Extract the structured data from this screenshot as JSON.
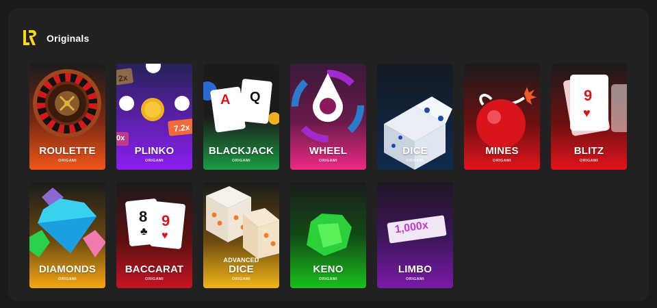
{
  "section": {
    "title": "Originals",
    "logo_icon": "lr-logo-icon",
    "logo_color": "#f5d90a"
  },
  "games": [
    {
      "title": "ROULETTE",
      "subtitle": "ORIGAMI",
      "icon": "roulette-wheel-icon",
      "colors": [
        "#1b1b1b",
        "#f2561b"
      ]
    },
    {
      "title": "PLINKO",
      "subtitle": "ORIGAMI",
      "icon": "plinko-board-icon",
      "colors": [
        "#27225a",
        "#8a1ff0"
      ],
      "chips": [
        "2x",
        "7.2x",
        "0x"
      ]
    },
    {
      "title": "BLACKJACK",
      "subtitle": "ORIGAMI",
      "icon": "playing-cards-icon",
      "colors": [
        "#1b1b1b",
        "#1a9d42"
      ],
      "cards": [
        "A",
        "Q"
      ]
    },
    {
      "title": "WHEEL",
      "subtitle": "ORIGAMI",
      "icon": "color-wheel-icon",
      "colors": [
        "#3a1a3a",
        "#ec2a84"
      ]
    },
    {
      "title": "DICE",
      "subtitle": "ORIGAMI",
      "icon": "dice-icon",
      "colors": [
        "#16202c",
        "#0f2a4d"
      ]
    },
    {
      "title": "MINES",
      "subtitle": "ORIGAMI",
      "icon": "bomb-icon",
      "colors": [
        "#1b1b1b",
        "#e2141c"
      ]
    },
    {
      "title": "BLITZ",
      "subtitle": "ORIGAMI",
      "icon": "playing-card-icon",
      "colors": [
        "#1b1b1b",
        "#e2141c"
      ],
      "cards": [
        "9"
      ]
    },
    {
      "title": "DIAMONDS",
      "subtitle": "ORIGAMI",
      "icon": "gems-icon",
      "colors": [
        "#1b1b1b",
        "#f7a713"
      ]
    },
    {
      "title": "BACCARAT",
      "subtitle": "ORIGAMI",
      "icon": "playing-cards-icon",
      "colors": [
        "#1b1b1b",
        "#c71424"
      ],
      "cards": [
        "8",
        "9"
      ]
    },
    {
      "title": "DICE",
      "pretitle": "ADVANCED",
      "subtitle": "ORIGAMI",
      "icon": "dice-pair-icon",
      "colors": [
        "#1b1b1b",
        "#f2b517"
      ]
    },
    {
      "title": "KENO",
      "subtitle": "ORIGAMI",
      "icon": "emerald-icon",
      "colors": [
        "#1b1b1b",
        "#18c01d"
      ]
    },
    {
      "title": "LIMBO",
      "subtitle": "ORIGAMI",
      "icon": "multiplier-ticket-icon",
      "colors": [
        "#2a1a35",
        "#7a1aa8"
      ],
      "badge": "1,000x"
    }
  ]
}
